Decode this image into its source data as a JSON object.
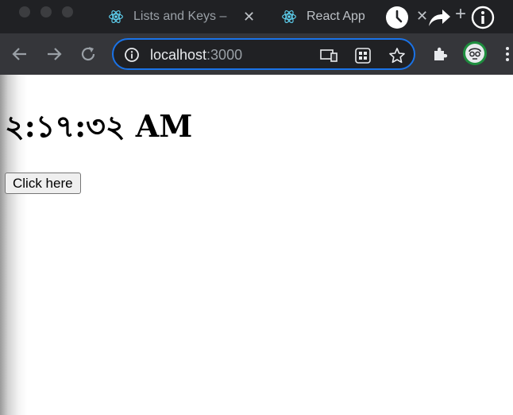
{
  "browser": {
    "tabs": [
      {
        "label": "Lists and Keys –",
        "favicon": "react-logo-icon"
      },
      {
        "label": "React App",
        "favicon": "react-logo-icon"
      }
    ],
    "url_host": "localhost",
    "url_port": ":3000",
    "icons": {
      "back": "arrow-left-icon",
      "forward": "arrow-right-icon",
      "reload": "reload-icon",
      "site_info": "info-icon",
      "cast": "cast-icon",
      "app": "grid-icon",
      "bookmark": "star-icon",
      "extensions": "puzzle-icon",
      "profile": "avatar-icon",
      "menu": "kebab-icon"
    },
    "overlay_icons": [
      "clock-icon",
      "share-arrow-icon",
      "plus-icon",
      "info-icon"
    ]
  },
  "page": {
    "clock_text": "২:১৭:৩২ AM",
    "button_label": "Click here"
  },
  "colors": {
    "titlebar": "#202124",
    "toolbar": "#35363a",
    "focus_ring": "#1a73e8",
    "react": "#61dafb"
  }
}
